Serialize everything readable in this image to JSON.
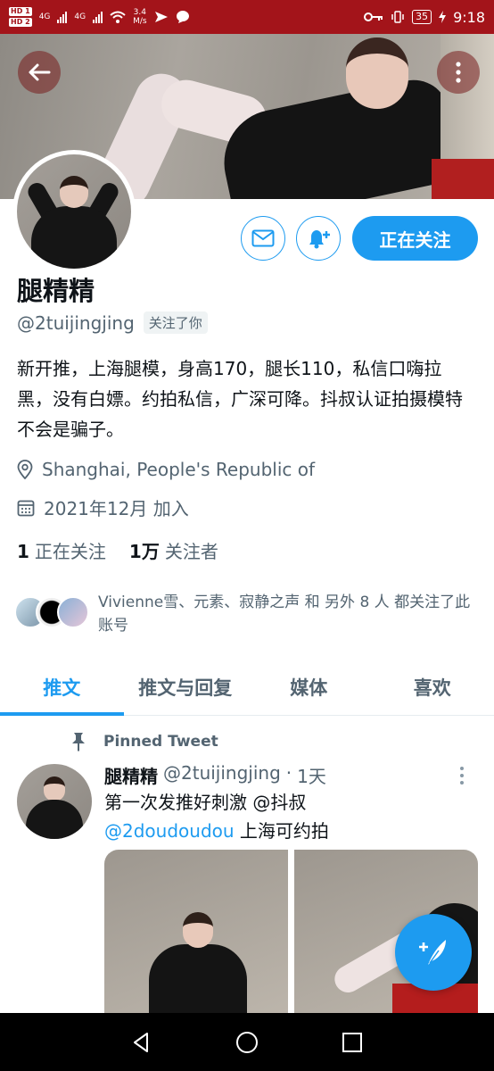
{
  "status_bar": {
    "hd1": "HD 1",
    "hd2": "HD 2",
    "net1": "4G",
    "net2": "4G",
    "speed_value": "3.4",
    "speed_unit": "M/s",
    "battery": "35",
    "time": "9:18"
  },
  "profile": {
    "name": "腿精精",
    "handle": "@2tuijingjing",
    "follows_you": "关注了你",
    "bio": "新开推，上海腿模，身高170，腿长110，私信口嗨拉黑，没有白嫖。约拍私信，广深可降。抖叔认证拍摄模特不会是骗子。",
    "location": "Shanghai, People's Republic of",
    "joined": "2021年12月 加入",
    "following_count": "1",
    "following_label": "正在关注",
    "followers_count": "1万",
    "followers_label": "关注者",
    "followed_by_text": "Vivienne雪、元素、寂静之声 和 另外 8 人 都关注了此账号",
    "follow_button": "正在关注"
  },
  "tabs": [
    {
      "label": "推文",
      "active": true
    },
    {
      "label": "推文与回复",
      "active": false
    },
    {
      "label": "媒体",
      "active": false
    },
    {
      "label": "喜欢",
      "active": false
    }
  ],
  "tweet": {
    "pinned_label": "Pinned Tweet",
    "author_name": "腿精精",
    "author_handle": "@2tuijingjing",
    "separator": "·",
    "time": "1天",
    "text_part1": "第一次发推好刺激 ",
    "mention1": "@抖叔",
    "mention2": "@2doudoudou",
    "text_part2": " 上海可约拍"
  },
  "colors": {
    "accent": "#1d9bf0",
    "status_bar": "#a3141a",
    "secondary_text": "#536471"
  },
  "icons": {
    "back": "arrow-left-icon",
    "more": "more-vertical-icon",
    "message": "envelope-icon",
    "notify": "bell-plus-icon",
    "location": "location-pin-icon",
    "calendar": "calendar-icon",
    "pin": "pushpin-icon",
    "compose": "feather-plus-icon"
  }
}
